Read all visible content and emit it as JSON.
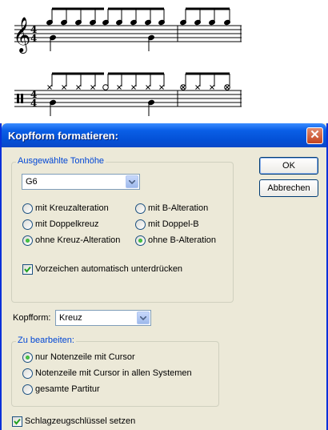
{
  "dialog": {
    "title": "Kopfform formatieren:",
    "close_glyph": "✕",
    "ok_label": "OK",
    "cancel_label": "Abbrechen"
  },
  "pitch_group": {
    "legend": "Ausgewählte Tonhöhe",
    "selected_pitch": "G6",
    "options": {
      "sharp": "mit Kreuzalteration",
      "flat": "mit B-Alteration",
      "double_sharp": "mit Doppelkreuz",
      "double_flat": "mit Doppel-B",
      "no_sharp": "ohne Kreuz-Alteration",
      "no_flat": "ohne B-Alteration"
    },
    "selected_options": [
      "no_sharp",
      "no_flat"
    ],
    "suppress_accidentals_label": "Vorzeichen automatisch unterdrücken",
    "suppress_accidentals_checked": true
  },
  "notehead": {
    "label": "Kopfform:",
    "value": "Kreuz"
  },
  "edit_scope": {
    "legend": "Zu bearbeiten:",
    "options": {
      "cursor_staff": "nur Notenzeile mit Cursor",
      "all_systems": "Notenzeile mit Cursor in allen Systemen",
      "full_score": "gesamte Partitur"
    },
    "selected": "cursor_staff"
  },
  "percussion_clef_label": "Schlagzeugschlüssel setzen",
  "percussion_clef_checked": true,
  "score": {
    "time_signature_top": "4",
    "time_signature_bottom": "4"
  }
}
